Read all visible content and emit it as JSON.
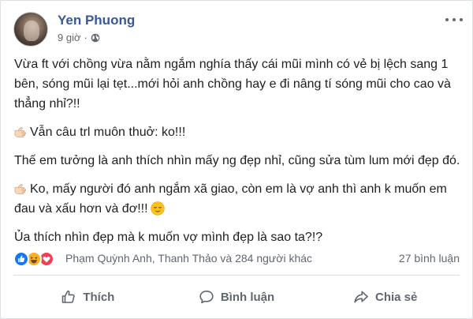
{
  "post": {
    "author": "Yen Phuong",
    "time": "9 giờ",
    "separator": "·",
    "privacy_icon": "globe-icon",
    "paragraphs": [
      "Vừa ft với chồng vừa nằm ngắm nghía thấy cái mũi mình có vẻ bị lệch sang 1 bên, sóng mũi lại tẹt...mới hỏi anh chồng hay e đi nâng tí sóng mũi cho cao và thẳng nhỉ?!!",
      "Vẫn câu trl muôn thuở: ko!!!",
      "Thế em tưởng là anh thích nhìn mấy ng đẹp nhỉ, cũng sửa tùm lum mới đẹp đó.",
      "Ko, mấy người đó anh ngắm xã giao, còn em là vợ anh thì anh k muốn em đau và xấu hơn và đơ!!!",
      "Ủa thích nhìn đẹp mà k muốn vợ mình đẹp là sao ta?!?"
    ]
  },
  "reactions": {
    "icons": [
      "like-icon",
      "haha-icon",
      "love-icon"
    ],
    "names": "Phạm Quỳnh Anh, Thanh Thảo và 284 người khác",
    "comments": "27 bình luận"
  },
  "actions": {
    "like_label": "Thích",
    "comment_label": "Bình luận",
    "share_label": "Chia sẻ"
  },
  "colors": {
    "author": "#385898",
    "muted": "#606770",
    "like": "#1877f2",
    "haha": "#f7b125",
    "love": "#f33e58"
  }
}
